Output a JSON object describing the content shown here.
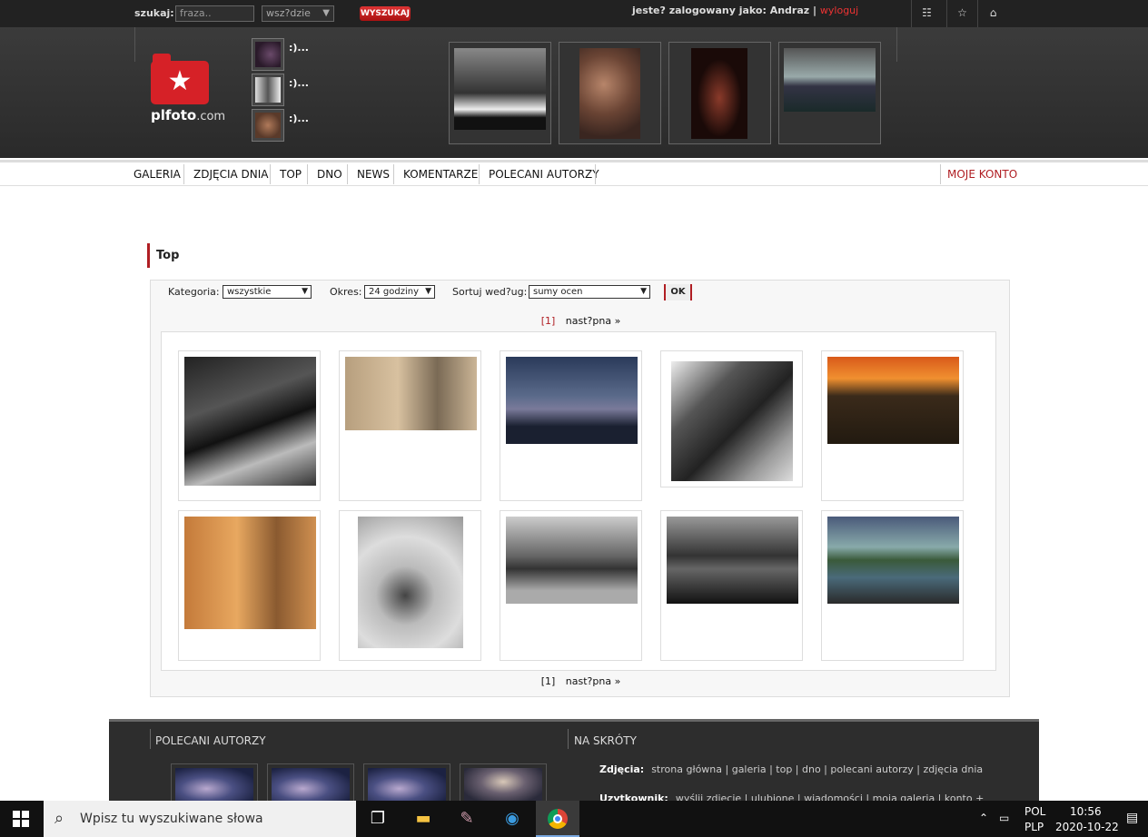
{
  "topbar": {
    "search_label": "szukaj:",
    "search_placeholder": "fraza..",
    "scope_value": "wsz?dzie",
    "search_button": "WYSZUKAJ",
    "user_text": "jeste? zalogowany jako: Andraz",
    "user_sep": "|",
    "logout": "wyloguj",
    "icons": [
      "list-icon",
      "star-icon",
      "home-icon"
    ]
  },
  "header": {
    "logo_name": "plfoto",
    "logo_tld": ".com",
    "recent": [
      {
        "label": ":)..."
      },
      {
        "label": ":)..."
      },
      {
        "label": ":)..."
      }
    ]
  },
  "nav": {
    "items": [
      "GALERIA",
      "ZDJĘCIA DNIA",
      "TOP",
      "DNO",
      "NEWS",
      "KOMENTARZE",
      "POLECANI AUTORZY"
    ],
    "account": "MOJE KONTO"
  },
  "main": {
    "title": "Top",
    "filters": {
      "category_label": "Kategoria:",
      "category_value": "wszystkie",
      "period_label": "Okres:",
      "period_value": "24 godziny",
      "sort_label": "Sortuj wed?ug:",
      "sort_value": "sumy ocen",
      "ok_button": "OK"
    },
    "pager": {
      "current": "[1]",
      "next": "nast?pna »"
    }
  },
  "footer": {
    "section_authors": "POLECANI AUTORZY",
    "section_shortcuts": "NA SKRÓTY",
    "photos_label": "Zdjęcia:",
    "photos_links": "strona główna | galeria | top | dno | polecani autorzy | zdjęcia dnia",
    "user_label": "Uzytkownik:",
    "user_links": "wyślij zdjęcie | ulubione | wiadomości | moja galeria | konto +"
  },
  "taskbar": {
    "search_placeholder": "Wpisz tu wyszukiwane słowa",
    "lang_top": "POL",
    "lang_bottom": "PLP",
    "time": "10:56",
    "date": "2020-10-22"
  }
}
